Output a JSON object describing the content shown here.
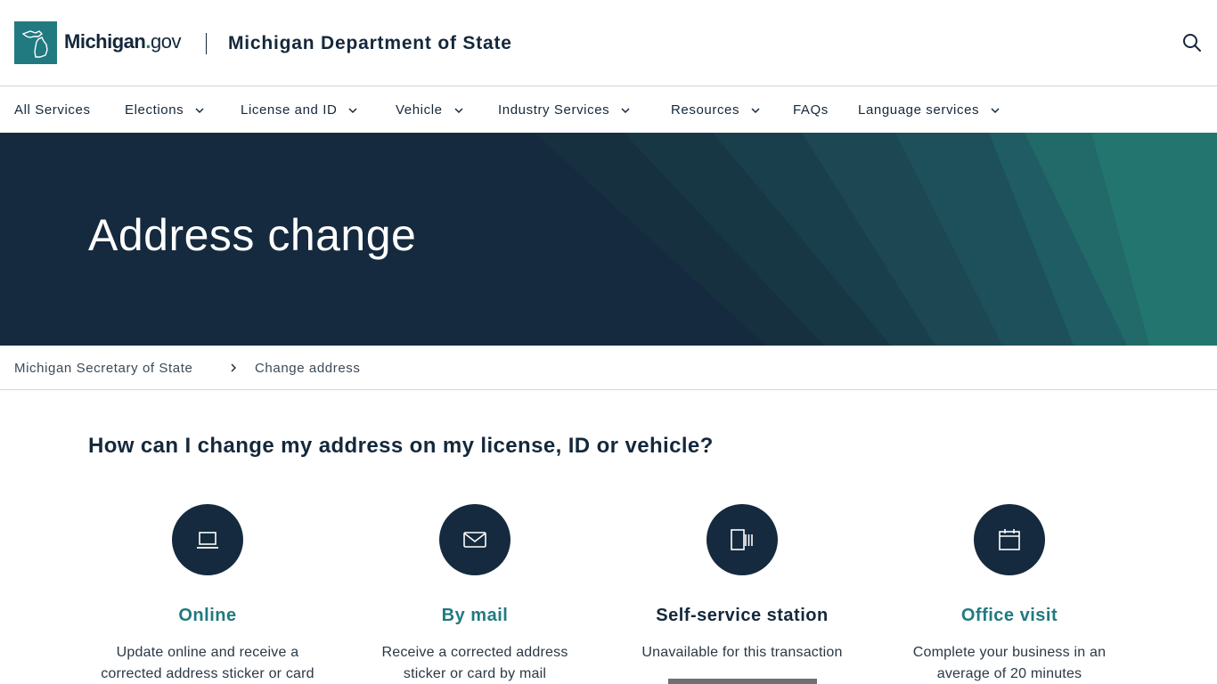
{
  "header": {
    "logo_text_main": "Michigan",
    "logo_text_dot": ".",
    "logo_text_gov": "gov",
    "department": "Michigan Department of State",
    "search_icon": "search-icon"
  },
  "nav": {
    "items": [
      {
        "label": "All Services",
        "has_dropdown": false
      },
      {
        "label": "Elections",
        "has_dropdown": true
      },
      {
        "label": "License and ID",
        "has_dropdown": true
      },
      {
        "label": "Vehicle",
        "has_dropdown": true
      },
      {
        "label": "Industry Services",
        "has_dropdown": true
      },
      {
        "label": "Resources",
        "has_dropdown": true
      },
      {
        "label": "FAQs",
        "has_dropdown": false
      },
      {
        "label": "Language services",
        "has_dropdown": true
      }
    ]
  },
  "hero": {
    "title": "Address change"
  },
  "breadcrumb": {
    "items": [
      "Michigan Secretary of State",
      "Change address"
    ]
  },
  "main": {
    "heading": "How can I change my address on my license, ID or vehicle?",
    "options": [
      {
        "icon": "laptop-icon",
        "title": "Online",
        "desc_line1": "Update online and receive a",
        "desc_line2": "corrected address sticker or card"
      },
      {
        "icon": "envelope-icon",
        "title": "By mail",
        "desc_line1": "Receive a corrected address",
        "desc_line2": "sticker or card by mail"
      },
      {
        "icon": "kiosk-icon",
        "title": "Self-service station",
        "desc_line1": "Unavailable for this transaction",
        "desc_line2": ""
      },
      {
        "icon": "calendar-icon",
        "title": "Office visit",
        "desc_line1": "Complete your business in an",
        "desc_line2": "average of 20 minutes"
      }
    ]
  },
  "colors": {
    "navy": "#152a3e",
    "teal": "#217a80",
    "text": "#14283b"
  }
}
